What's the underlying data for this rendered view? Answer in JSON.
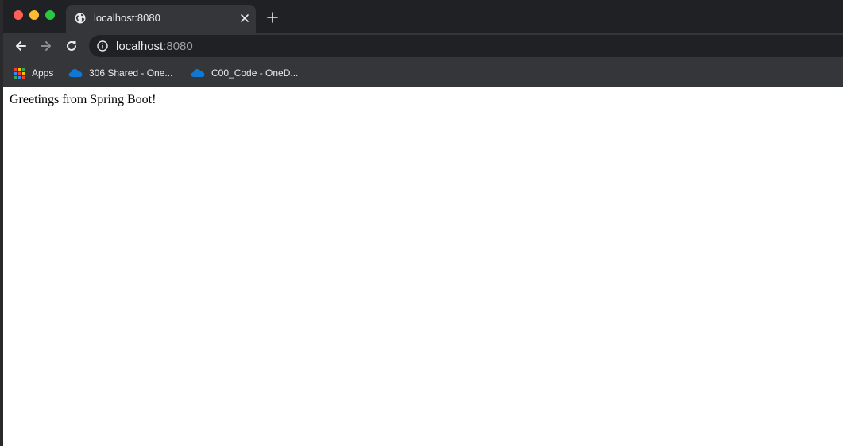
{
  "tab": {
    "title": "localhost:8080"
  },
  "toolbar": {
    "url_host": "localhost",
    "url_port": ":8080"
  },
  "bookmarks": {
    "items": [
      {
        "label": "Apps",
        "icon": "apps-grid-icon"
      },
      {
        "label": "306 Shared - One...",
        "icon": "onedrive-cloud-icon"
      },
      {
        "label": "C00_Code - OneD...",
        "icon": "onedrive-cloud-icon"
      }
    ]
  },
  "page": {
    "text": "Greetings from Spring Boot!"
  },
  "colors": {
    "frame": "#202124",
    "toolbar": "#35363a",
    "close": "#ff5f57",
    "minimize": "#febc2e",
    "maximize": "#28c840",
    "onedrive": "#0f78d4"
  }
}
